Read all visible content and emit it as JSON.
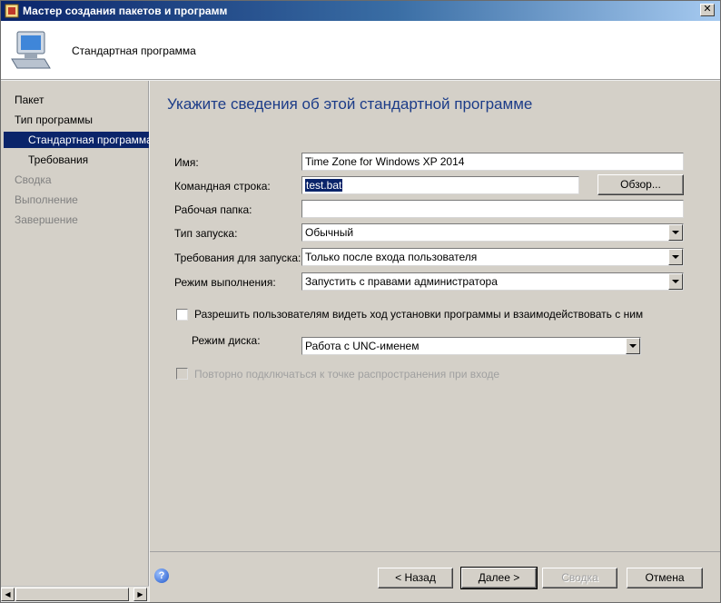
{
  "window": {
    "title": "Мастер создания пакетов и программ",
    "close_glyph": "✕"
  },
  "banner": {
    "title": "Стандартная программа",
    "icon": "computer-icon"
  },
  "nav": {
    "items": [
      {
        "label": "Пакет",
        "state": "normal"
      },
      {
        "label": "Тип программы",
        "state": "normal"
      },
      {
        "label": "Стандартная программа",
        "state": "active"
      },
      {
        "label": "Требования",
        "state": "normal"
      },
      {
        "label": "Сводка",
        "state": "disabled"
      },
      {
        "label": "Выполнение",
        "state": "disabled"
      },
      {
        "label": "Завершение",
        "state": "disabled"
      }
    ]
  },
  "main": {
    "heading": "Укажите сведения об этой стандартной программе",
    "name_label": "Имя:",
    "name_value": "Time Zone for Windows XP 2014",
    "cmd_label": "Командная строка:",
    "cmd_value": "test.bat",
    "browse_label": "Обзор...",
    "workdir_label": "Рабочая папка:",
    "workdir_value": "",
    "run_type_label": "Тип запуска:",
    "run_type_value": "Обычный",
    "run_req_label": "Требования для запуска:",
    "run_req_value": "Только после входа пользователя",
    "run_mode_label": "Режим выполнения:",
    "run_mode_value": "Запустить с правами администратора",
    "allow_interact_label": "Разрешить пользователям видеть ход установки программы и взаимодействовать с ним",
    "disk_mode_label": "Режим диска:",
    "disk_mode_value": "Работа с UNC-именем",
    "reconnect_label": "Повторно подключаться к точке распространения при входе"
  },
  "footer": {
    "back_label": "< Назад",
    "next_label": "Далее >",
    "summary_label": "Сводка",
    "cancel_label": "Отмена",
    "help_glyph": "?"
  }
}
